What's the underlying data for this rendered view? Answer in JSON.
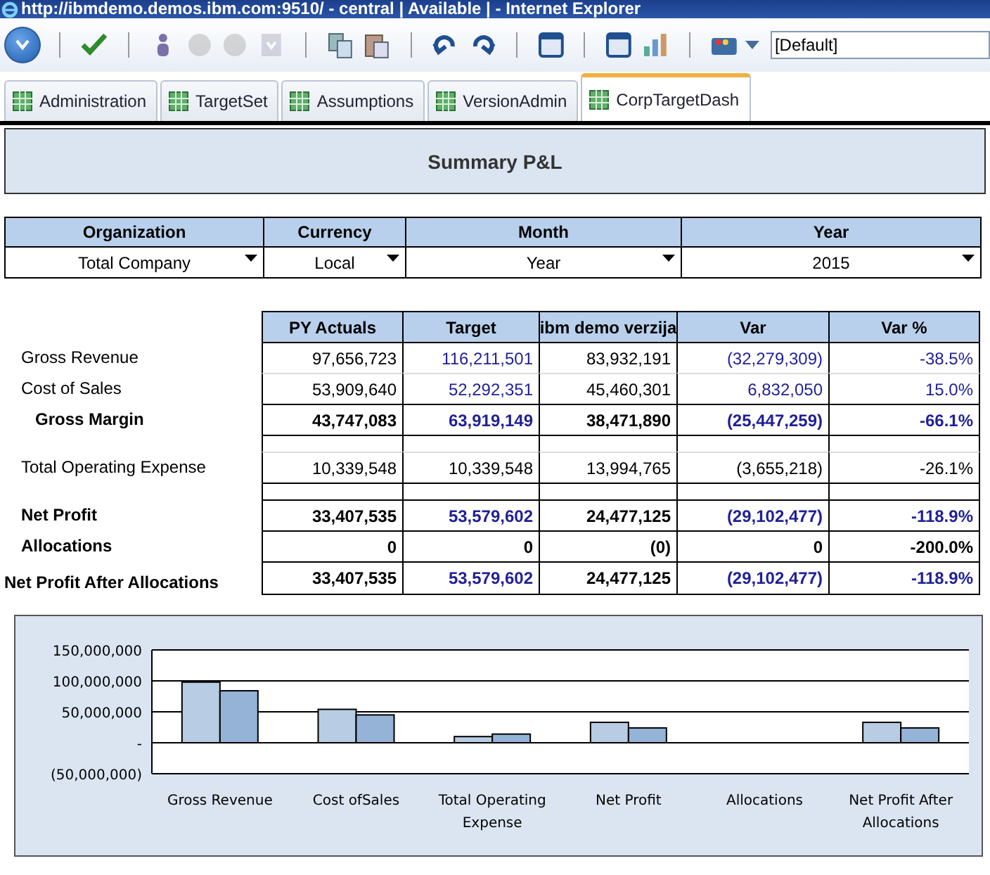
{
  "window": {
    "title": "http://ibmdemo.demos.ibm.com:9510/ - central | Available | - Internet Explorer"
  },
  "toolbar": [
    {
      "kind": "menu"
    },
    {
      "kind": "sep"
    },
    {
      "kind": "check",
      "disabled": false
    },
    {
      "kind": "sep"
    },
    {
      "kind": "person",
      "disabled": false
    },
    {
      "kind": "circle",
      "disabled": true
    },
    {
      "kind": "circle",
      "disabled": true
    },
    {
      "kind": "download",
      "disabled": true
    },
    {
      "kind": "sep"
    },
    {
      "kind": "copy",
      "disabled": false
    },
    {
      "kind": "paste",
      "disabled": false
    },
    {
      "kind": "sep"
    },
    {
      "kind": "undo",
      "disabled": false
    },
    {
      "kind": "redo",
      "disabled": false
    },
    {
      "kind": "sep"
    },
    {
      "kind": "window",
      "disabled": false
    },
    {
      "kind": "sep"
    },
    {
      "kind": "window2",
      "disabled": false
    },
    {
      "kind": "chart",
      "disabled": false
    },
    {
      "kind": "sep"
    },
    {
      "kind": "palette",
      "disabled": false
    }
  ],
  "view_field": {
    "value": "[Default]"
  },
  "tabs": [
    {
      "label": "Administration",
      "selected": false
    },
    {
      "label": "TargetSet",
      "selected": false
    },
    {
      "label": "Assumptions",
      "selected": false
    },
    {
      "label": "VersionAdmin",
      "selected": false
    },
    {
      "label": "CorpTargetDash",
      "selected": true
    }
  ],
  "report_title": "Summary P&L",
  "filters": [
    {
      "label": "Organization",
      "value": "Total Company"
    },
    {
      "label": "Currency",
      "value": "Local"
    },
    {
      "label": "Month",
      "value": "Year"
    },
    {
      "label": "Year",
      "value": "2015"
    }
  ],
  "table": {
    "columns": [
      "PY Actuals",
      "Target",
      "ibm demo verzija",
      "Var",
      "Var %"
    ],
    "rows": [
      {
        "kind": "line",
        "label": "Gross Revenue",
        "cells": [
          {
            "text": "97,656,723",
            "color": "#000000"
          },
          {
            "text": "116,211,501",
            "color": "#1f1f99"
          },
          {
            "text": "83,932,191",
            "color": "#000000"
          },
          {
            "text": "(32,279,309)",
            "color": "#1f1f99"
          },
          {
            "text": "-38.5%",
            "color": "#1f1f99"
          }
        ]
      },
      {
        "kind": "line",
        "label": "Cost of Sales",
        "cells": [
          {
            "text": "53,909,640",
            "color": "#000000"
          },
          {
            "text": "52,292,351",
            "color": "#1f1f99"
          },
          {
            "text": "45,460,301",
            "color": "#000000"
          },
          {
            "text": "6,832,050",
            "color": "#1f1f99"
          },
          {
            "text": "15.0%",
            "color": "#1f1f99"
          }
        ]
      },
      {
        "kind": "subtotal",
        "label": "Gross Margin",
        "cells": [
          {
            "text": "43,747,083",
            "color": "#000000"
          },
          {
            "text": "63,919,149",
            "color": "#1f1f99"
          },
          {
            "text": "38,471,890",
            "color": "#000000"
          },
          {
            "text": "(25,447,259)",
            "color": "#1f1f99"
          },
          {
            "text": "-66.1%",
            "color": "#1f1f99"
          }
        ]
      },
      {
        "kind": "spacer"
      },
      {
        "kind": "line",
        "label": "Total Operating Expense",
        "cells": [
          {
            "text": "10,339,548",
            "color": "#000000"
          },
          {
            "text": "10,339,548",
            "color": "#000000"
          },
          {
            "text": "13,994,765",
            "color": "#000000"
          },
          {
            "text": "(3,655,218)",
            "color": "#000000"
          },
          {
            "text": "-26.1%",
            "color": "#000000"
          }
        ]
      },
      {
        "kind": "spacer"
      },
      {
        "kind": "total",
        "label": "Net Profit",
        "cells": [
          {
            "text": "33,407,535",
            "color": "#000000"
          },
          {
            "text": "53,579,602",
            "color": "#1f1f99"
          },
          {
            "text": "24,477,125",
            "color": "#000000"
          },
          {
            "text": "(29,102,477)",
            "color": "#1f1f99"
          },
          {
            "text": "-118.9%",
            "color": "#1f1f99"
          }
        ]
      },
      {
        "kind": "total",
        "label": "Allocations",
        "cells": [
          {
            "text": "0",
            "color": "#000000"
          },
          {
            "text": "0",
            "color": "#000000"
          },
          {
            "text": "(0)",
            "color": "#000000"
          },
          {
            "text": "0",
            "color": "#000000"
          },
          {
            "text": "-200.0%",
            "color": "#000000"
          }
        ]
      },
      {
        "kind": "grand",
        "label": "Net Profit After Allocations",
        "cells": [
          {
            "text": "33,407,535",
            "color": "#000000"
          },
          {
            "text": "53,579,602",
            "color": "#1f1f99"
          },
          {
            "text": "24,477,125",
            "color": "#000000"
          },
          {
            "text": "(29,102,477)",
            "color": "#1f1f99"
          },
          {
            "text": "-118.9%",
            "color": "#1f1f99"
          }
        ]
      }
    ]
  },
  "chart": {
    "chart_data": {
      "type": "bar",
      "categories": [
        "Gross Revenue",
        "Cost ofSales",
        "Total Operating Expense",
        "Net Profit",
        "Allocations",
        "Net Profit After Allocations"
      ],
      "series": [
        {
          "color": "#b8cce4",
          "values": [
            98000000,
            54000000,
            10000000,
            33000000,
            0,
            33000000
          ]
        },
        {
          "color": "#95b3d7",
          "values": [
            84000000,
            45000000,
            14000000,
            24000000,
            0,
            24000000
          ]
        }
      ],
      "grid": true,
      "ylim": [
        -50000000,
        150000000
      ],
      "yticks": [
        {
          "value": 150000000,
          "label": "150,000,000"
        },
        {
          "value": 100000000,
          "label": "100,000,000"
        },
        {
          "value": 50000000,
          "label": "50,000,000"
        },
        {
          "value": 0,
          "label": "-"
        },
        {
          "value": -50000000,
          "label": "(50,000,000)"
        }
      ]
    }
  }
}
